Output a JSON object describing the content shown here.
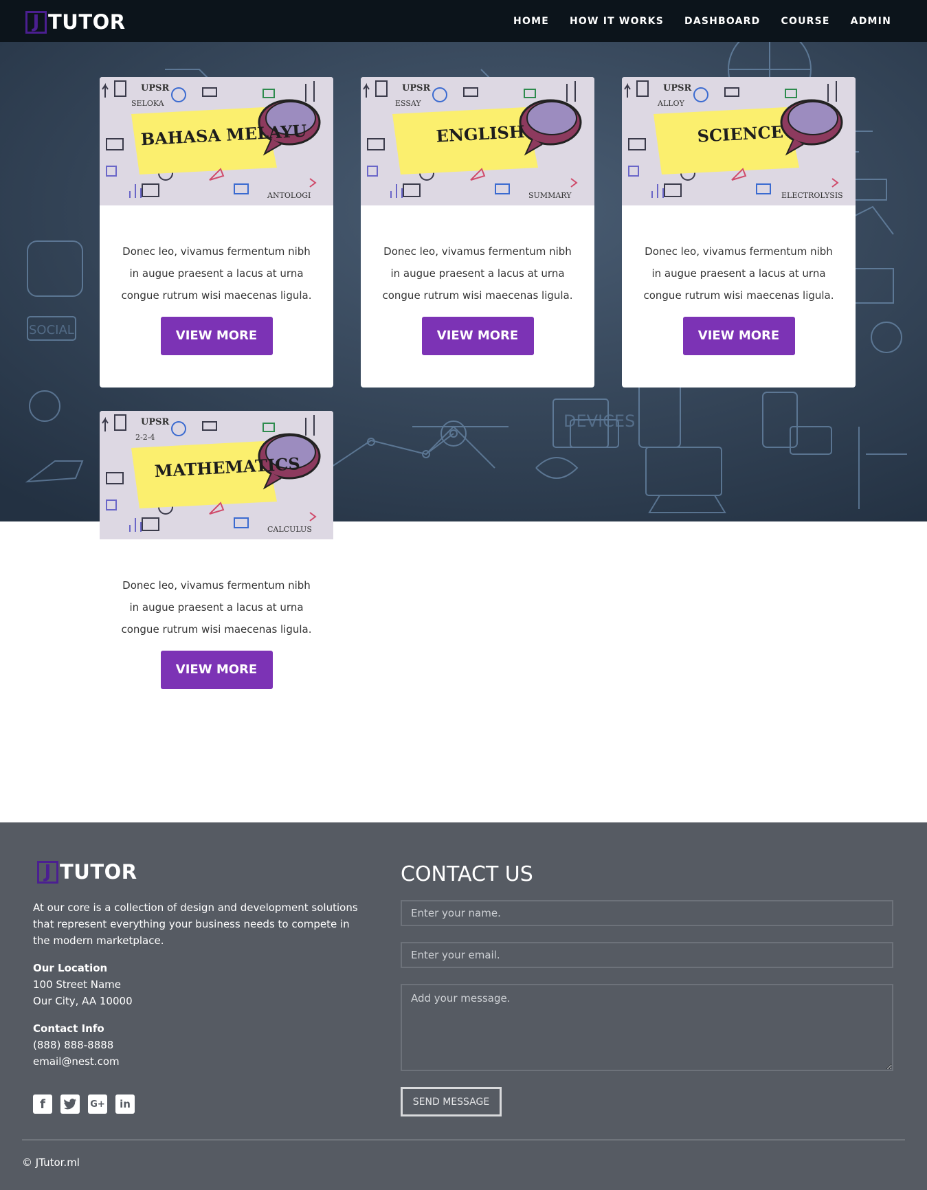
{
  "nav": {
    "brand_letter": "J",
    "brand_name": "TUTOR",
    "links": [
      "HOME",
      "HOW IT WORKS",
      "DASHBOARD",
      "COURSE",
      "ADMIN"
    ]
  },
  "courses": [
    {
      "title": "BAHASA MELAYU",
      "corner_top": "UPSR",
      "corner_sub": "SELOKA",
      "corner_bottom": "ANTOLOGI",
      "text": "Donec leo, vivamus fermentum nibh in augue praesent a lacus at urna congue rutrum wisi maecenas ligula.",
      "button": "VIEW MORE"
    },
    {
      "title": "ENGLISH",
      "corner_top": "UPSR",
      "corner_sub": "ESSAY",
      "corner_bottom": "SUMMARY",
      "text": "Donec leo, vivamus fermentum nibh in augue praesent a lacus at urna congue rutrum wisi maecenas ligula.",
      "button": "VIEW MORE"
    },
    {
      "title": "SCIENCE",
      "corner_top": "UPSR",
      "corner_sub": "ALLOY",
      "corner_bottom": "ELECTROLYSIS",
      "text": "Donec leo, vivamus fermentum nibh in augue praesent a lacus at urna congue rutrum wisi maecenas ligula.",
      "button": "VIEW MORE"
    },
    {
      "title": "MATHEMATICS",
      "corner_top": "UPSR",
      "corner_sub": "2-2-4",
      "corner_bottom": "CALCULUS",
      "text": "Donec leo, vivamus fermentum nibh in augue praesent a lacus at urna congue rutrum wisi maecenas ligula.",
      "button": "VIEW MORE"
    }
  ],
  "footer": {
    "brand_letter": "J",
    "brand_name": "TUTOR",
    "about": "At our core is a collection of design and development solutions that represent everything your business needs to compete in the modern marketplace.",
    "location_heading": "Our Location",
    "address_line1": "100 Street Name",
    "address_line2": "Our City, AA 10000",
    "contact_heading": "Contact Info",
    "phone": "(888) 888-8888",
    "email": "email@nest.com",
    "socials": [
      "facebook-icon",
      "twitter-icon",
      "google-plus-icon",
      "linkedin-icon"
    ],
    "contact_title": "CONTACT US",
    "name_placeholder": "Enter your name.",
    "email_placeholder": "Enter your email.",
    "message_placeholder": "Add your message.",
    "send_label": "SEND MESSAGE",
    "copyright": "© JTutor.ml"
  },
  "colors": {
    "nav_bg": "#0c141b",
    "hero_bg": "#2b3a4c",
    "accent": "#7c33b5",
    "brand_box": "#4b1f91",
    "footer_bg": "#565b63",
    "sticky_note": "#fbef6e"
  }
}
